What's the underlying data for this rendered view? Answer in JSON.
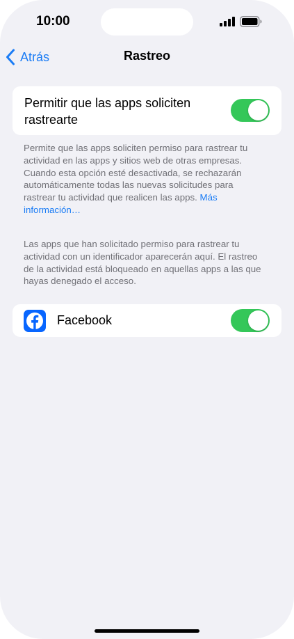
{
  "status_bar": {
    "time": "10:00",
    "signal_icon": "cellular-signal-icon",
    "battery_icon": "battery-full-icon"
  },
  "nav": {
    "back_label": "Atrás",
    "back_icon": "chevron-left-icon",
    "title": "Rastreo"
  },
  "permit": {
    "label": "Permitir que las apps soliciten rastrearte",
    "enabled": true
  },
  "footnotes": {
    "permit_description": "Permite que las apps soliciten permiso para rastrear tu actividad en las apps y sitios web de otras empresas. Cuando esta opción esté desactivada, se rechazarán automáticamente todas las nuevas solicitudes para rastrear tu actividad que realicen las apps.",
    "more_info_link": "Más información…",
    "apps_description": "Las apps que han solicitado permiso para rastrear tu actividad con un identificador aparecerán aquí. El rastreo de la actividad está bloqueado en aquellas apps a las que hayas denegado el acceso."
  },
  "apps": [
    {
      "name": "Facebook",
      "icon": "facebook-icon",
      "enabled": true
    }
  ],
  "colors": {
    "accent": "#1a7cf5",
    "toggle_on": "#34c759",
    "background": "#f1f1f6",
    "facebook_blue": "#0866ff"
  }
}
